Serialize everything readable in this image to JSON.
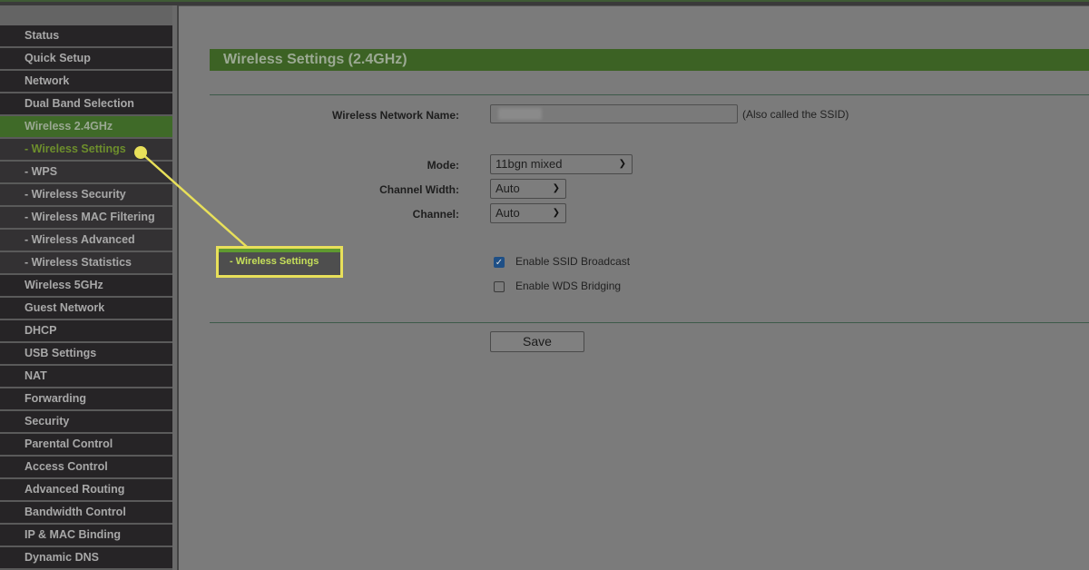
{
  "sidebar": {
    "items": [
      {
        "label": "Status",
        "type": "main"
      },
      {
        "label": "Quick Setup",
        "type": "main"
      },
      {
        "label": "Network",
        "type": "main"
      },
      {
        "label": "Dual Band Selection",
        "type": "main"
      },
      {
        "label": "Wireless 2.4GHz",
        "type": "active"
      },
      {
        "label": "- Wireless Settings",
        "type": "current"
      },
      {
        "label": "- WPS",
        "type": "sub"
      },
      {
        "label": "- Wireless Security",
        "type": "sub"
      },
      {
        "label": "- Wireless MAC Filtering",
        "type": "sub"
      },
      {
        "label": "- Wireless Advanced",
        "type": "sub"
      },
      {
        "label": "- Wireless Statistics",
        "type": "sub"
      },
      {
        "label": "Wireless 5GHz",
        "type": "main"
      },
      {
        "label": "Guest Network",
        "type": "main"
      },
      {
        "label": "DHCP",
        "type": "main"
      },
      {
        "label": "USB Settings",
        "type": "main"
      },
      {
        "label": "NAT",
        "type": "main"
      },
      {
        "label": "Forwarding",
        "type": "main"
      },
      {
        "label": "Security",
        "type": "main"
      },
      {
        "label": "Parental Control",
        "type": "main"
      },
      {
        "label": "Access Control",
        "type": "main"
      },
      {
        "label": "Advanced Routing",
        "type": "main"
      },
      {
        "label": "Bandwidth Control",
        "type": "main"
      },
      {
        "label": "IP & MAC Binding",
        "type": "main"
      },
      {
        "label": "Dynamic DNS",
        "type": "main"
      }
    ]
  },
  "page": {
    "title": "Wireless Settings (2.4GHz)",
    "ssid_label": "Wireless Network Name:",
    "ssid_value": "",
    "ssid_hint": "(Also called the SSID)",
    "mode_label": "Mode:",
    "mode_value": "11bgn mixed",
    "channel_width_label": "Channel Width:",
    "channel_width_value": "Auto",
    "channel_label": "Channel:",
    "channel_value": "Auto",
    "ssid_broadcast_label": "Enable SSID Broadcast",
    "ssid_broadcast_checked": true,
    "wds_label": "Enable WDS Bridging",
    "wds_checked": false,
    "save_label": "Save"
  },
  "callout": {
    "label": "- Wireless Settings",
    "color": "#e8e05a"
  },
  "colors": {
    "accent_green": "#3c6224",
    "highlight_yellow": "#e8e05a",
    "checkbox_blue": "#1e4f86"
  }
}
